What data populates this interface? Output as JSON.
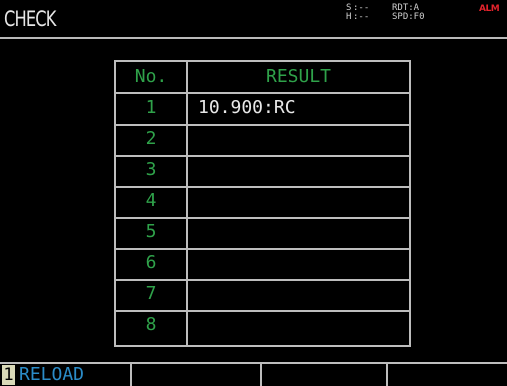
{
  "screen": {
    "title": "CHECK"
  },
  "status": {
    "col1": [
      "S",
      "H"
    ],
    "col2": [
      ":--",
      ":--"
    ],
    "col3": [
      "RDT:A",
      "SPD:F0"
    ],
    "alarm": "ALM",
    "alarm_color": "#e3232c"
  },
  "table": {
    "headers": {
      "no": "No.",
      "result": "RESULT"
    },
    "rows": [
      {
        "no": "1",
        "result": "10.900:RC"
      },
      {
        "no": "2",
        "result": ""
      },
      {
        "no": "3",
        "result": ""
      },
      {
        "no": "4",
        "result": ""
      },
      {
        "no": "5",
        "result": ""
      },
      {
        "no": "6",
        "result": ""
      },
      {
        "no": "7",
        "result": ""
      },
      {
        "no": "8",
        "result": ""
      }
    ],
    "accent_color": "#2fa24a"
  },
  "function_keys": [
    {
      "num": "1",
      "label": "RELOAD"
    },
    {
      "num": "",
      "label": ""
    },
    {
      "num": "",
      "label": ""
    },
    {
      "num": "",
      "label": ""
    }
  ]
}
